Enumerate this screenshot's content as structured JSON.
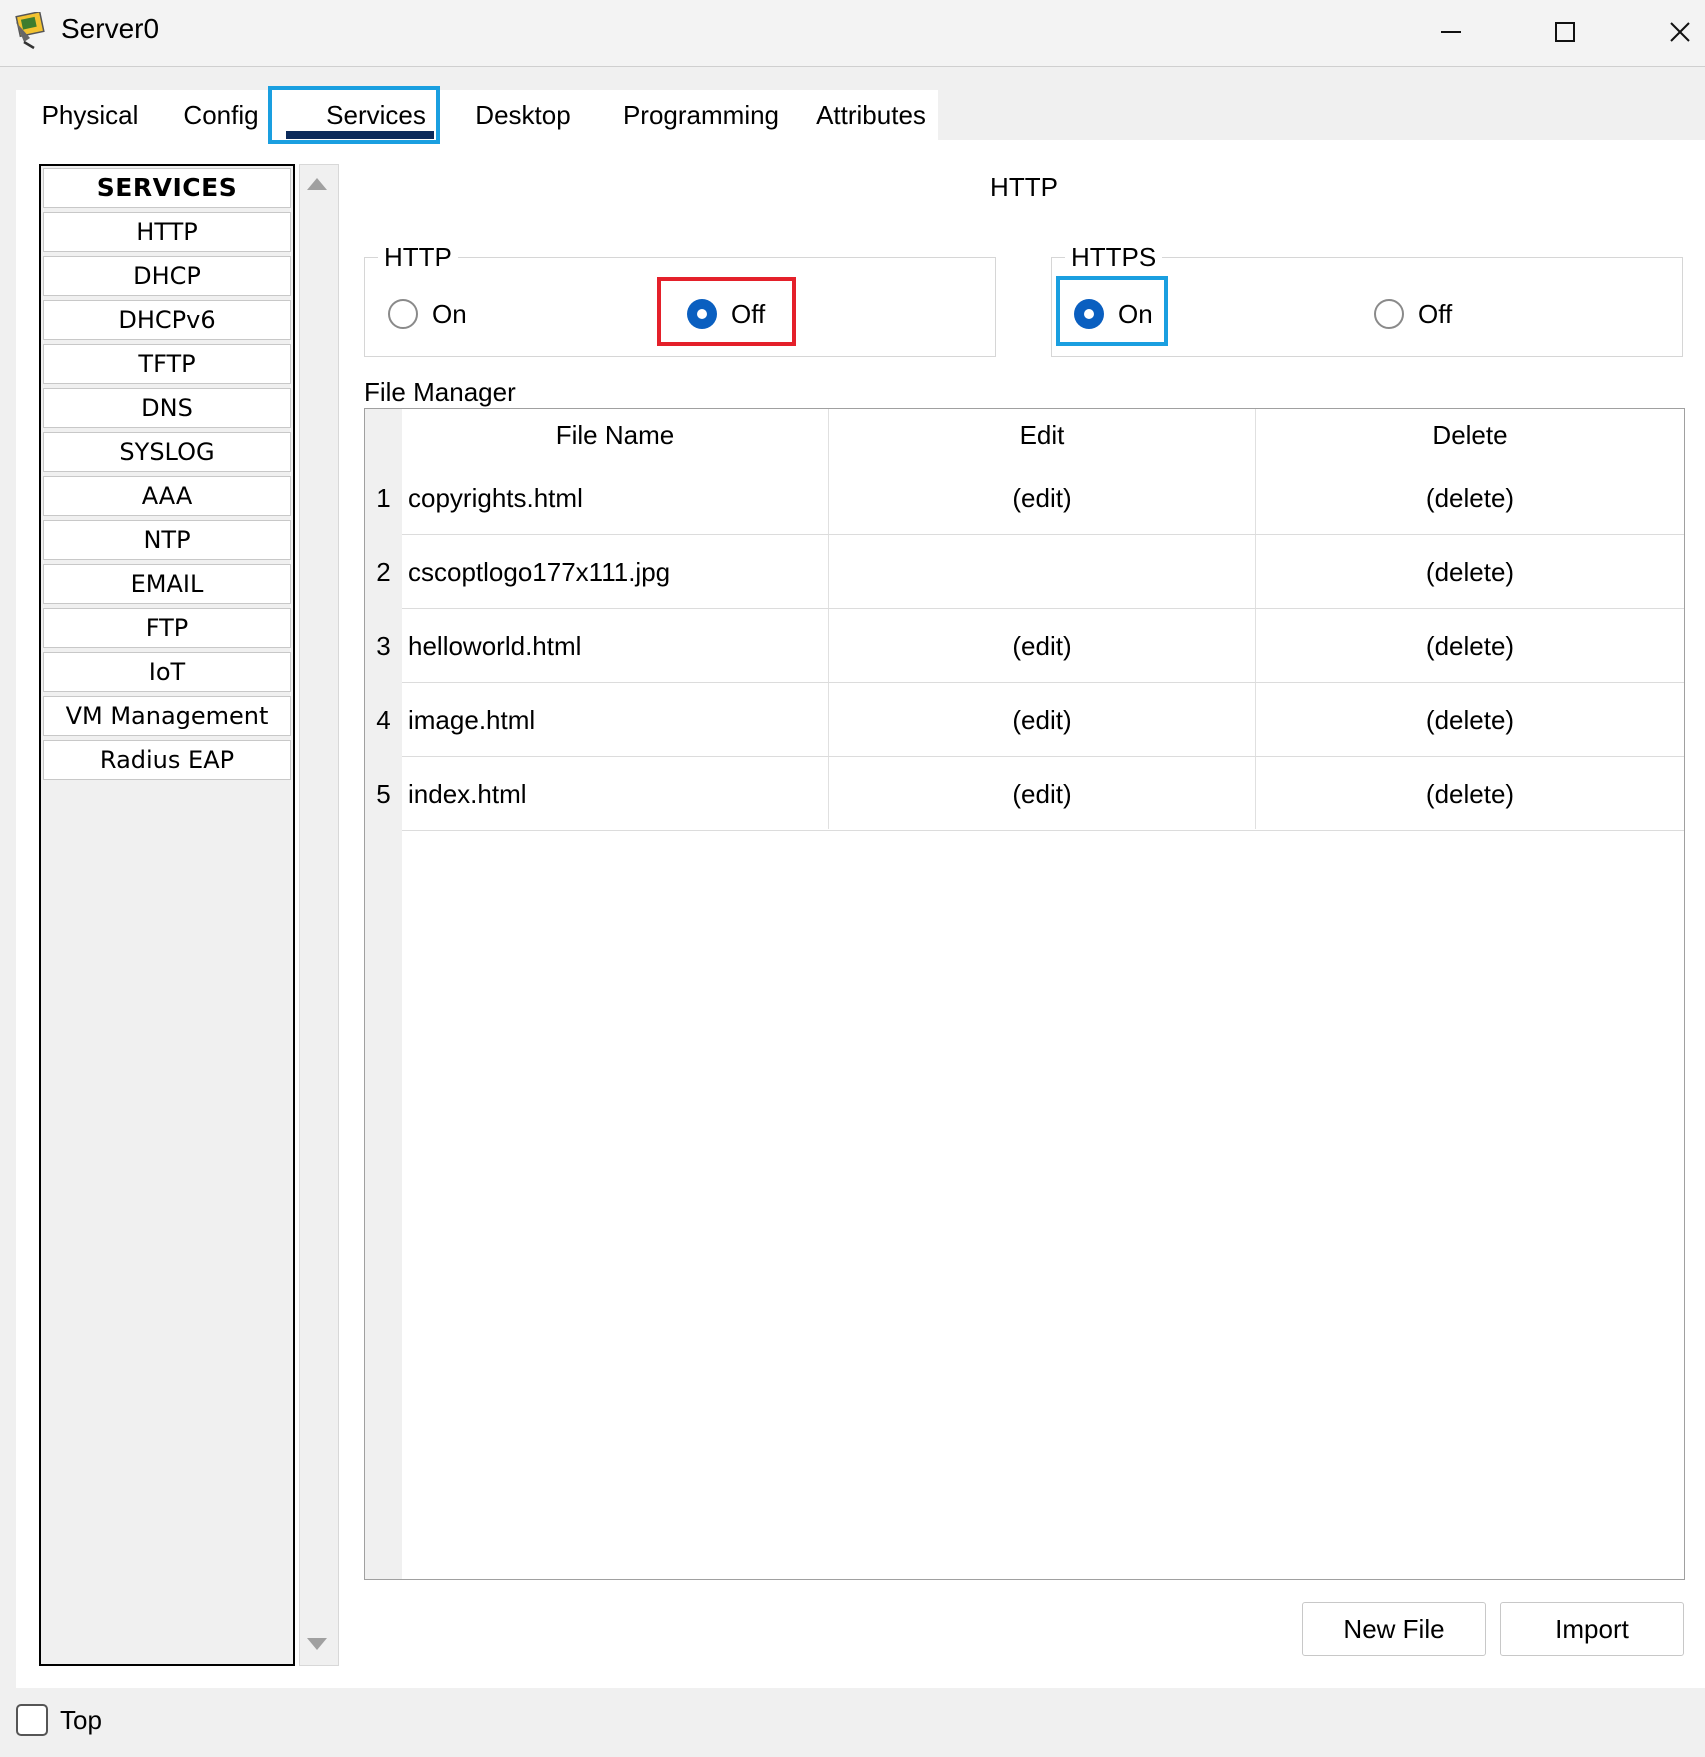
{
  "window": {
    "title": "Server0",
    "icon": "server-icon"
  },
  "tabs": [
    "Physical",
    "Config",
    "Services",
    "Desktop",
    "Programming",
    "Attributes"
  ],
  "active_tab": "Services",
  "sidebar": {
    "header": "SERVICES",
    "items": [
      "HTTP",
      "DHCP",
      "DHCPv6",
      "TFTP",
      "DNS",
      "SYSLOG",
      "AAA",
      "NTP",
      "EMAIL",
      "FTP",
      "IoT",
      "VM Management",
      "Radius EAP"
    ]
  },
  "main": {
    "title": "HTTP",
    "http": {
      "legend": "HTTP",
      "on_label": "On",
      "off_label": "Off",
      "selected": "Off"
    },
    "https": {
      "legend": "HTTPS",
      "on_label": "On",
      "off_label": "Off",
      "selected": "On"
    },
    "file_manager": {
      "label": "File Manager",
      "columns": [
        "File Name",
        "Edit",
        "Delete"
      ],
      "rows": [
        {
          "num": "1",
          "name": "copyrights.html",
          "edit": "(edit)",
          "delete": "(delete)"
        },
        {
          "num": "2",
          "name": "cscoptlogo177x111.jpg",
          "edit": "",
          "delete": "(delete)"
        },
        {
          "num": "3",
          "name": "helloworld.html",
          "edit": "(edit)",
          "delete": "(delete)"
        },
        {
          "num": "4",
          "name": "image.html",
          "edit": "(edit)",
          "delete": "(delete)"
        },
        {
          "num": "5",
          "name": "index.html",
          "edit": "(edit)",
          "delete": "(delete)"
        }
      ]
    },
    "buttons": {
      "new_file": "New File",
      "import": "Import"
    }
  },
  "footer": {
    "top_label": "Top",
    "top_checked": false
  },
  "colors": {
    "radio_selected": "#0a5fc0",
    "highlight_blue": "#1a9fe0",
    "highlight_red": "#e4202a",
    "tab_underline": "#0b2a5b"
  }
}
